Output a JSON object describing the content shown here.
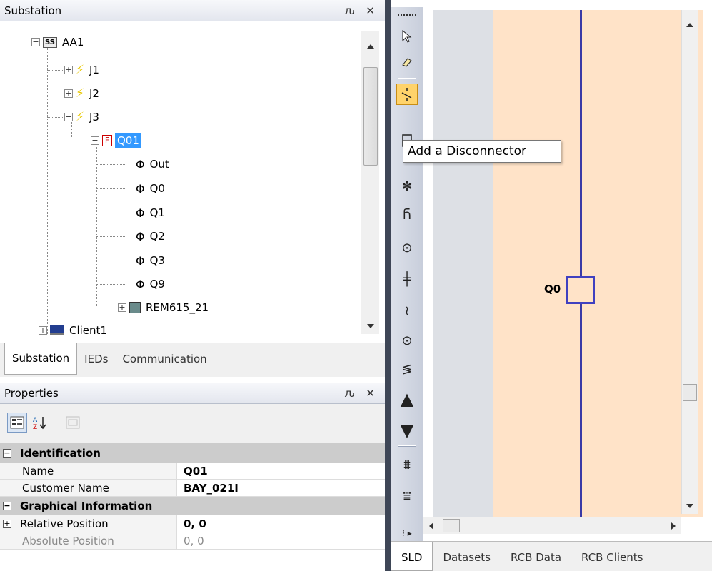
{
  "substation_panel": {
    "title": "Substation",
    "pin": "ԉ",
    "close": "✕",
    "tree": [
      {
        "label": "AA1",
        "icon": "substation-icon"
      },
      {
        "label": "J1",
        "icon": "voltage-level-icon"
      },
      {
        "label": "J2",
        "icon": "voltage-level-icon"
      },
      {
        "label": "J3",
        "icon": "voltage-level-icon"
      },
      {
        "label": "Q01",
        "icon": "bay-icon"
      },
      {
        "label": "Out",
        "icon": "connectivity-node-icon"
      },
      {
        "label": "Q0",
        "icon": "connectivity-node-icon"
      },
      {
        "label": "Q1",
        "icon": "connectivity-node-icon"
      },
      {
        "label": "Q2",
        "icon": "connectivity-node-icon"
      },
      {
        "label": "Q3",
        "icon": "connectivity-node-icon"
      },
      {
        "label": "Q9",
        "icon": "connectivity-node-icon"
      },
      {
        "label": "REM615_21",
        "icon": "ied-icon"
      },
      {
        "label": "Client1",
        "icon": "client-icon"
      }
    ]
  },
  "bottom_tabs": [
    "Substation",
    "IEDs",
    "Communication"
  ],
  "properties_panel": {
    "title": "Properties",
    "pin": "ԉ",
    "close": "✕",
    "categories": [
      {
        "name": "Identification",
        "rows": [
          {
            "name": "Name",
            "value": "Q01"
          },
          {
            "name": "Customer Name",
            "value": "BAY_021I"
          }
        ]
      },
      {
        "name": "Graphical Information",
        "rows": [
          {
            "name": "Relative Position",
            "value": "0, 0"
          },
          {
            "name": "Absolute Position",
            "value": "0, 0"
          }
        ]
      }
    ]
  },
  "tooltip": "Add a Disconnector",
  "diagram": {
    "disconnector_label": "Q0"
  },
  "right_tabs": [
    "SLD",
    "Datasets",
    "RCB Data",
    "RCB Clients"
  ],
  "colors": {
    "selection": "#3399ff",
    "bay_zone": "#ffe3c8",
    "busbar": "#3a3aa6",
    "active_tool": "#ffd36b"
  }
}
